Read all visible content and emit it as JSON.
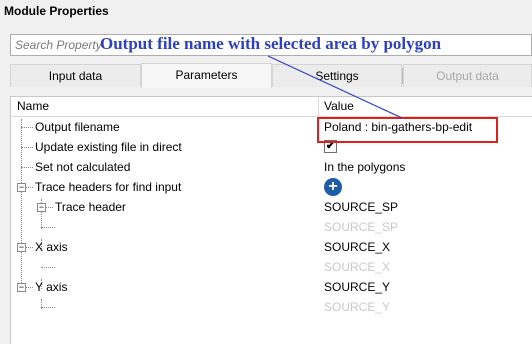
{
  "window": {
    "title": "Module Properties"
  },
  "search": {
    "placeholder": "Search Property"
  },
  "annotation": {
    "text": "Output file name with selected area by polygon"
  },
  "tabs": [
    {
      "label": "Input data",
      "state": "normal"
    },
    {
      "label": "Parameters",
      "state": "active"
    },
    {
      "label": "Settings",
      "state": "normal"
    },
    {
      "label": "Output data",
      "state": "disabled"
    }
  ],
  "grid": {
    "name_header": "Name",
    "value_header": "Value",
    "rows": [
      {
        "name": "Output filename",
        "value": "Poland : bin-gathers-bp-edit"
      },
      {
        "name": "Update existing file in direct",
        "value_type": "checkbox",
        "checked": true,
        "check_glyph": "✔"
      },
      {
        "name": "Set not calculated",
        "value": "In the polygons"
      },
      {
        "name": "Trace headers for find input",
        "value_type": "add-button",
        "expander": "−",
        "add_glyph": "+"
      },
      {
        "name": "Trace header",
        "value": "SOURCE_SP",
        "expander": "−"
      },
      {
        "name": "",
        "value": "SOURCE_SP",
        "placeholder": true
      },
      {
        "name": "X axis",
        "value": "SOURCE_X",
        "expander": "−"
      },
      {
        "name": "",
        "value": "SOURCE_X",
        "placeholder": true
      },
      {
        "name": "Y axis",
        "value": "SOURCE_Y",
        "expander": "−"
      },
      {
        "name": "",
        "value": "SOURCE_Y",
        "placeholder": true
      }
    ]
  },
  "colors": {
    "annotation": "#2d3fc4",
    "highlight_border": "#e0201e",
    "add_button": "#1f5ca8",
    "placeholder_text": "#c8c8c8"
  },
  "icons": {
    "add": "plus-circle-icon",
    "checkbox": "checkbox-icon",
    "expander": "collapse-icon"
  }
}
